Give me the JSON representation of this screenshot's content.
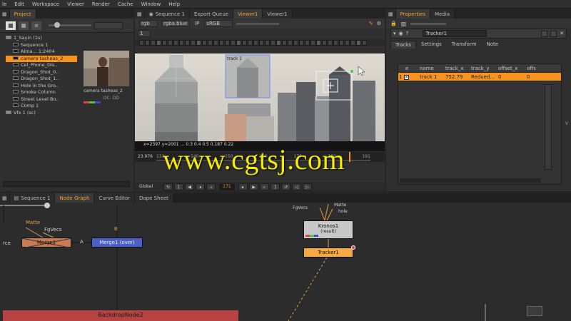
{
  "menu": [
    "le",
    "Edit",
    "Workspace",
    "Viewer",
    "Render",
    "Cache",
    "Window",
    "Help"
  ],
  "project": {
    "tab": "Project",
    "tree": [
      {
        "label": "1_Sayin (1s)",
        "indent": 0
      },
      {
        "label": "Sequence 1",
        "indent": 1
      },
      {
        "label": "Alma... 1:2404",
        "indent": 1
      },
      {
        "label": "camera tasheas_2",
        "indent": 1,
        "selected": true
      },
      {
        "label": "Cel_Phone_Dis..",
        "indent": 1
      },
      {
        "label": "Dragon_Shot_0..",
        "indent": 1
      },
      {
        "label": "Dragon_Shot_1..",
        "indent": 1
      },
      {
        "label": "Hole in the Gro..",
        "indent": 1
      },
      {
        "label": "Smoke Column",
        "indent": 1
      },
      {
        "label": "Street Level Bo..",
        "indent": 1
      },
      {
        "label": "Comp 1",
        "indent": 1
      },
      {
        "label": "Vfx 1 (sc)",
        "indent": 0
      }
    ],
    "thumb_label": "camera tasheas_2",
    "thumb_sub": "DC: DD"
  },
  "viewer_tabs": [
    "Sequence 1",
    "Export Queue",
    "Viewer1",
    "Viewer1"
  ],
  "viewer_toolbar": {
    "channel": "rgb",
    "alpha": "rgba.blue",
    "ip": "IP",
    "lut": "sRGB",
    "zoom": "1"
  },
  "viewer": {
    "readout": "x=2397 y=2001 … 0.3 0.4 0.5 0.187 0.22",
    "fps": "23.976",
    "frame": "171",
    "timeline_ticks": [
      "131",
      "140",
      "150",
      "160",
      "170",
      "180",
      "191"
    ],
    "global": "Global",
    "overlay_label": "track 1"
  },
  "properties": {
    "tabs": [
      "Properties",
      "Media"
    ],
    "node_name": "Tracker1",
    "subtabs": [
      "Tracks",
      "Settings",
      "Transform",
      "Note"
    ],
    "columns": [
      "e",
      "name",
      "track_x",
      "track_y",
      "offset_x",
      "offs"
    ],
    "rows": [
      {
        "num": "1",
        "name": "track 1",
        "track_x": "752.79",
        "track_y": "Redued...",
        "offset_x": "0",
        "offs": "0"
      }
    ]
  },
  "node_tabs": [
    "Sequence 1",
    "Node Graph",
    "Curve Editor",
    "Dope Sheet"
  ],
  "nodes": {
    "matte": "Matte",
    "fgvec": "FgVecs",
    "source": "rce",
    "a_label": "A",
    "b_label": "B",
    "disabled_node": "Merge1",
    "merge_over": "Merge1 (over)",
    "kronos_label": "Kronos1",
    "kronos_sub": "(result)",
    "tracker_label": "Tracker1",
    "top_fgvec": "FgVecs",
    "top_matte": "Matte",
    "top_hole": "hole",
    "backdrop": "BackdropNode2"
  },
  "watermark": "www.cgtsj.com",
  "colors": {
    "accent": "#f7931e",
    "selection": "#f7931e",
    "node_blue": "#4a5fc8",
    "backdrop": "#b64242",
    "watermark": "#f5ea00"
  }
}
